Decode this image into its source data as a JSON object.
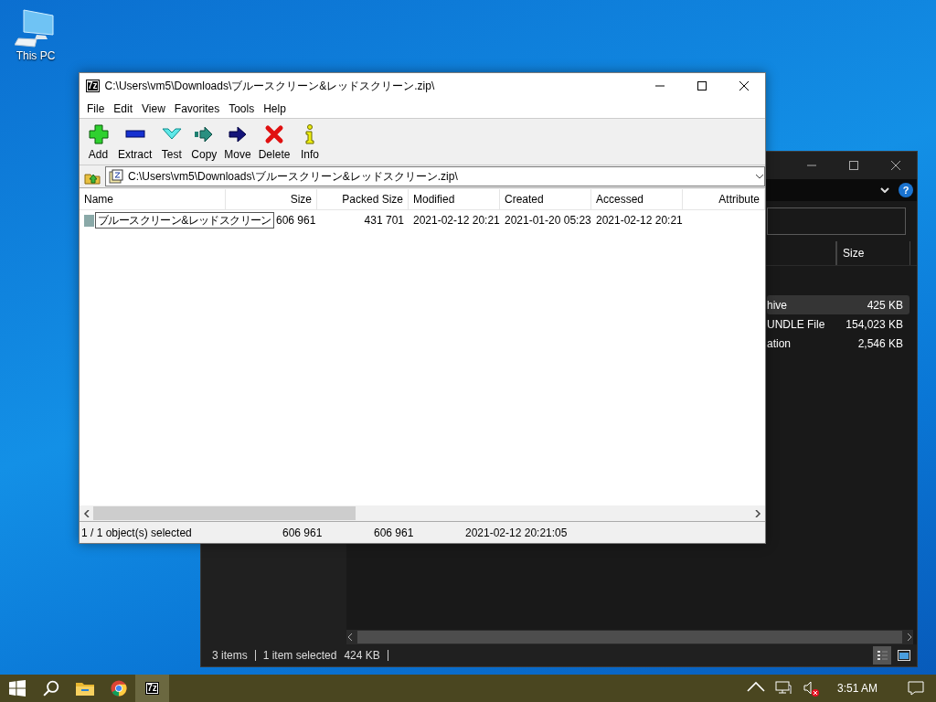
{
  "desktop_icons": [
    {
      "kind": "computer",
      "label": "This PC"
    }
  ],
  "explorer_window": {
    "help_button": "?",
    "columns": [
      "Size"
    ],
    "rows": [
      {
        "type": "hive",
        "size": "425 KB",
        "selected": true
      },
      {
        "type": "UNDLE File",
        "size": "154,023 KB",
        "selected": false
      },
      {
        "type": "ation",
        "size": "2,546 KB",
        "selected": false
      }
    ],
    "status_bar": {
      "items": "3 items",
      "selection": "1 item selected",
      "selection_size": "424 KB"
    }
  },
  "archive_window": {
    "icon_text": "7z",
    "title": "C:\\Users\\vm5\\Downloads\\ブルースクリーン&レッドスクリーン.zip\\",
    "menu": [
      "File",
      "Edit",
      "View",
      "Favorites",
      "Tools",
      "Help"
    ],
    "toolbar": [
      {
        "kind": "add",
        "label": "Add"
      },
      {
        "kind": "extract",
        "label": "Extract"
      },
      {
        "kind": "test",
        "label": "Test"
      },
      {
        "kind": "copy",
        "label": "Copy"
      },
      {
        "kind": "move",
        "label": "Move"
      },
      {
        "kind": "delete",
        "label": "Delete"
      },
      {
        "kind": "info",
        "label": "Info"
      }
    ],
    "address": "C:\\Users\\vm5\\Downloads\\ブルースクリーン&レッドスクリーン.zip\\",
    "columns": [
      "Name",
      "Size",
      "Packed Size",
      "Modified",
      "Created",
      "Accessed",
      "Attribute"
    ],
    "rows": [
      {
        "name": "ブルースクリーン&レッドスクリーン",
        "editing": true,
        "size": "606 961",
        "packed_size": "431 701",
        "modified": "2021-02-12 20:21",
        "created": "2021-01-20 05:23",
        "accessed": "2021-02-12 20:21"
      }
    ],
    "status_bar": [
      "1 / 1 object(s) selected",
      "606 961",
      "606 961",
      "2021-02-12 20:21:05"
    ]
  },
  "taskbar": {
    "apps": [
      {
        "kind": "start",
        "selected": false
      },
      {
        "kind": "search",
        "selected": false
      },
      {
        "kind": "folder",
        "selected": false
      },
      {
        "kind": "browser",
        "selected": false
      },
      {
        "kind": "archiver",
        "icon_text": "7z",
        "selected": true
      }
    ],
    "tray": [
      {
        "kind": "chevron"
      },
      {
        "kind": "network"
      },
      {
        "kind": "volume",
        "muted": true
      }
    ],
    "clock": "3:51 AM"
  }
}
